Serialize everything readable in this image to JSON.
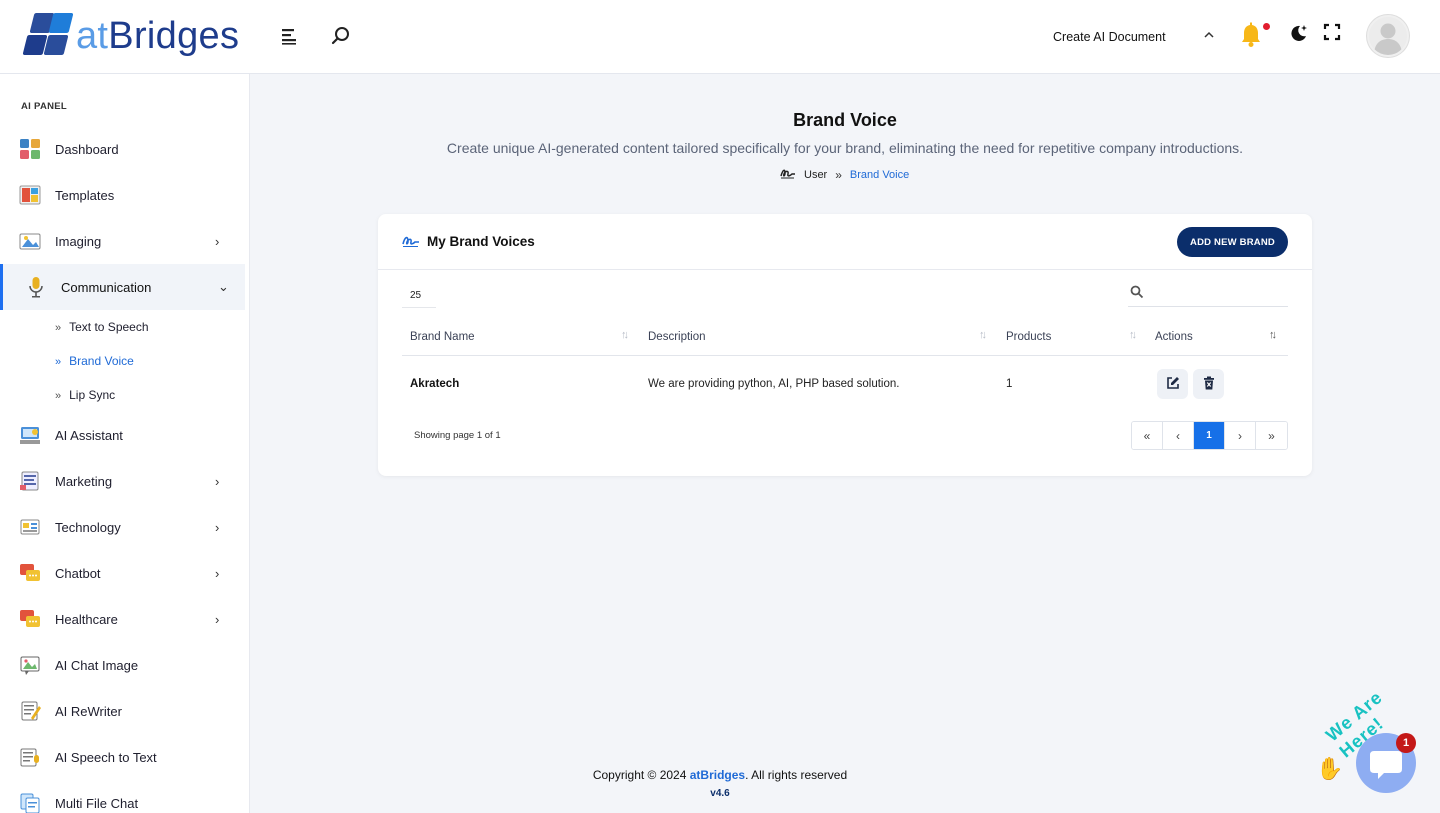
{
  "header": {
    "logo": {
      "at": "at",
      "bridges": "Bridges"
    },
    "create_doc": "Create AI Document",
    "icons": [
      "menu-icon",
      "search-icon",
      "chevron-up-icon",
      "bell-icon",
      "moon-icon",
      "fullscreen-icon",
      "avatar"
    ],
    "notification_dot_color": "#e11d2e"
  },
  "sidebar": {
    "panel_label": "AI PANEL",
    "items": [
      {
        "label": "Dashboard",
        "icon": "dashboard-icon",
        "has_arrow": false
      },
      {
        "label": "Templates",
        "icon": "templates-icon",
        "has_arrow": false
      },
      {
        "label": "Imaging",
        "icon": "imaging-icon",
        "has_arrow": true
      },
      {
        "label": "Communication",
        "icon": "microphone-icon",
        "has_arrow": true,
        "expanded": true
      },
      {
        "label": "AI Assistant",
        "icon": "assistant-icon",
        "has_arrow": false
      },
      {
        "label": "Marketing",
        "icon": "marketing-icon",
        "has_arrow": true
      },
      {
        "label": "Technology",
        "icon": "technology-icon",
        "has_arrow": true
      },
      {
        "label": "Chatbot",
        "icon": "chatbot-icon",
        "has_arrow": true
      },
      {
        "label": "Healthcare",
        "icon": "healthcare-icon",
        "has_arrow": true
      },
      {
        "label": "AI Chat Image",
        "icon": "chat-image-icon",
        "has_arrow": false
      },
      {
        "label": "AI ReWriter",
        "icon": "rewriter-icon",
        "has_arrow": false
      },
      {
        "label": "AI Speech to Text",
        "icon": "speech-to-text-icon",
        "has_arrow": false
      },
      {
        "label": "Multi File Chat",
        "icon": "multi-file-chat-icon",
        "has_arrow": false
      }
    ],
    "sub_items": [
      {
        "label": "Text to Speech",
        "current": false
      },
      {
        "label": "Brand Voice",
        "current": true
      },
      {
        "label": "Lip Sync",
        "current": false
      }
    ]
  },
  "page": {
    "title": "Brand Voice",
    "subtitle": "Create unique AI-generated content tailored specifically for your brand, eliminating the need for repetitive company introductions.",
    "breadcrumb": {
      "parent": "User",
      "current": "Brand Voice"
    }
  },
  "card": {
    "title": "My Brand Voices",
    "add_button": "ADD NEW BRAND",
    "page_length": "25",
    "search_placeholder": "",
    "columns": [
      "Brand Name",
      "Description",
      "Products",
      "Actions"
    ],
    "rows": [
      {
        "brand_name": "Akratech",
        "description": "We are providing python, AI, PHP based solution.",
        "products": "1"
      }
    ],
    "showing": "Showing page 1 of 1",
    "pager": {
      "first": "«",
      "prev": "‹",
      "current": "1",
      "next": "›",
      "last": "»"
    }
  },
  "footer": {
    "copyright_prefix": "Copyright © 2024 ",
    "brand": "atBridges",
    "suffix": ". All rights reserved",
    "version": "v4.6"
  },
  "chat_widget": {
    "label": "We Are Here!",
    "badge": "1"
  },
  "colors": {
    "accent": "#1f6ad6",
    "primary_dark": "#0b2e6b",
    "pager_active": "#1670e8"
  }
}
